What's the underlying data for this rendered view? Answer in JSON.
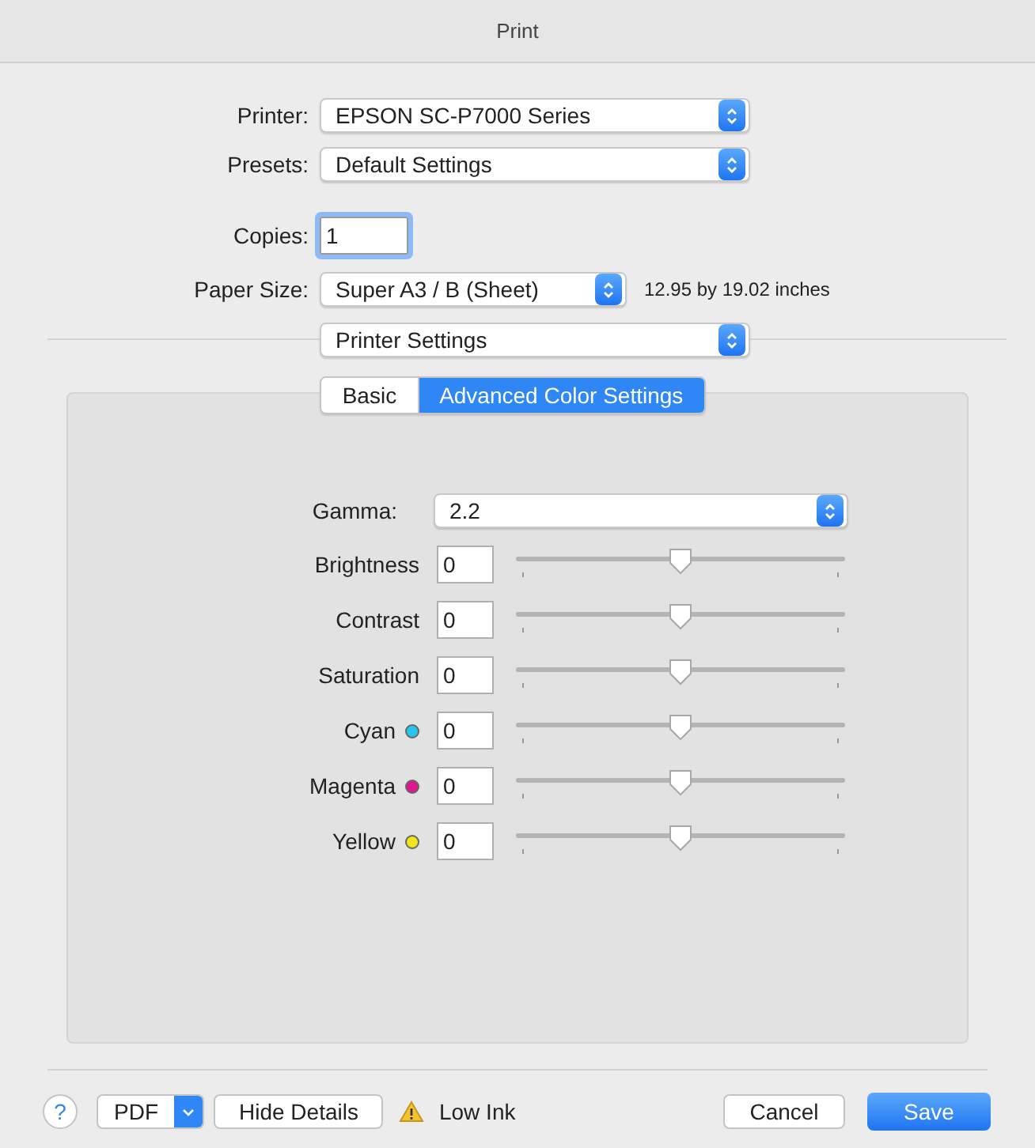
{
  "window": {
    "title": "Print"
  },
  "fields": [
    {
      "label": "Printer:",
      "kind": "popup",
      "value": "EPSON SC-P7000 Series"
    },
    {
      "label": "Presets:",
      "kind": "popup",
      "value": "Default Settings"
    },
    {
      "label": "Copies:",
      "kind": "input",
      "value": "1"
    },
    {
      "label": "Paper Size:",
      "kind": "popup",
      "value": "Super A3 / B (Sheet)",
      "note": "12.95 by 19.02 inches"
    }
  ],
  "section_popup": {
    "value": "Printer Settings"
  },
  "tabs": [
    {
      "label": "Basic",
      "selected": false
    },
    {
      "label": "Advanced Color Settings",
      "selected": true
    }
  ],
  "gamma": {
    "label": "Gamma:",
    "value": "2.2"
  },
  "adjustments": [
    {
      "label": "Brightness",
      "value": "0",
      "level": 0.5
    },
    {
      "label": "Contrast",
      "value": "0",
      "level": 0.5
    },
    {
      "label": "Saturation",
      "value": "0",
      "level": 0.5
    },
    {
      "label": "Cyan",
      "value": "0",
      "level": 0.5,
      "color": "#27c4f0"
    },
    {
      "label": "Magenta",
      "value": "0",
      "level": 0.5,
      "color": "#e0168c"
    },
    {
      "label": "Yellow",
      "value": "0",
      "level": 0.5,
      "color": "#f2e41a"
    }
  ],
  "footer": {
    "help": "?",
    "pdf": "PDF",
    "details": "Hide Details",
    "warning": "Low Ink",
    "cancel": "Cancel",
    "save": "Save"
  }
}
